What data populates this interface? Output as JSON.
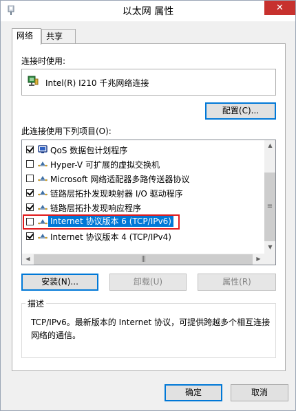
{
  "window": {
    "title": "以太网 属性",
    "close_glyph": "✕"
  },
  "tabs": [
    {
      "label": "网络",
      "active": true
    },
    {
      "label": "共享",
      "active": false
    }
  ],
  "connect_using": {
    "label": "连接时使用:",
    "adapter_name": "Intel(R) I210 千兆网络连接",
    "configure_button": "配置(C)..."
  },
  "items_section": {
    "label": "此连接使用下列项目(O):",
    "items": [
      {
        "checked": true,
        "icon": "qos-icon",
        "label": "QoS 数据包计划程序",
        "selected": false
      },
      {
        "checked": false,
        "icon": "protocol-icon",
        "label": "Hyper-V 可扩展的虚拟交换机",
        "selected": false
      },
      {
        "checked": false,
        "icon": "protocol-icon",
        "label": "Microsoft 网络适配器多路传送器协议",
        "selected": false
      },
      {
        "checked": true,
        "icon": "protocol-icon",
        "label": "链路层拓扑发现映射器 I/O 驱动程序",
        "selected": false
      },
      {
        "checked": true,
        "icon": "protocol-icon",
        "label": "链路层拓扑发现响应程序",
        "selected": false
      },
      {
        "checked": false,
        "icon": "protocol-icon",
        "label": "Internet 协议版本 6 (TCP/IPv6)",
        "selected": true
      },
      {
        "checked": true,
        "icon": "protocol-icon",
        "label": "Internet 协议版本 4 (TCP/IPv4)",
        "selected": false
      }
    ]
  },
  "actions": {
    "install": "安装(N)...",
    "uninstall": "卸载(U)",
    "properties": "属性(R)"
  },
  "description": {
    "legend": "描述",
    "text": "TCP/IPv6。最新版本的 Internet 协议，可提供跨越多个相互连接网络的通信。"
  },
  "footer": {
    "ok": "确定",
    "cancel": "取消"
  },
  "colors": {
    "selection": "#0078d7",
    "highlight_box": "#e0191b",
    "close_button": "#c7312e"
  }
}
